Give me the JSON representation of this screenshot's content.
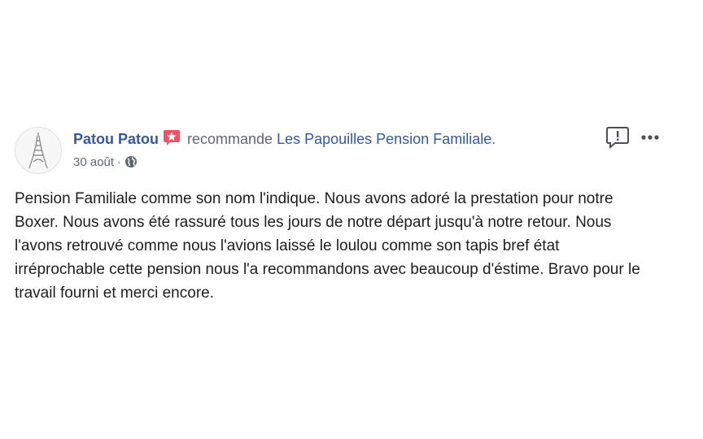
{
  "post": {
    "author": "Patou Patou",
    "verb": "recommande",
    "page_name": "Les Papouilles Pension Familiale",
    "page_suffix": ".",
    "date": "30 août",
    "meta_separator": "·",
    "privacy_icon": "globe-icon",
    "badge_icon": "recommendation-star-icon",
    "report_icon": "report-speech-bubble-icon",
    "more_icon": "more-options-icon",
    "text": "Pension Familiale comme son nom l'indique. Nous avons adoré la prestation pour notre Boxer. Nous avons été rassuré tous les jours de notre départ jusqu'à notre retour. Nous l'avons retrouvé comme nous l'avions laissé le loulou comme son tapis bref état irréprochable cette pension nous l'a recommandons avec beaucoup d'éstime. Bravo pour le travail fourni et merci encore."
  },
  "colors": {
    "link": "#385898",
    "secondary_text": "#606770",
    "body_text": "#1c1e21",
    "badge": "#f25268"
  }
}
